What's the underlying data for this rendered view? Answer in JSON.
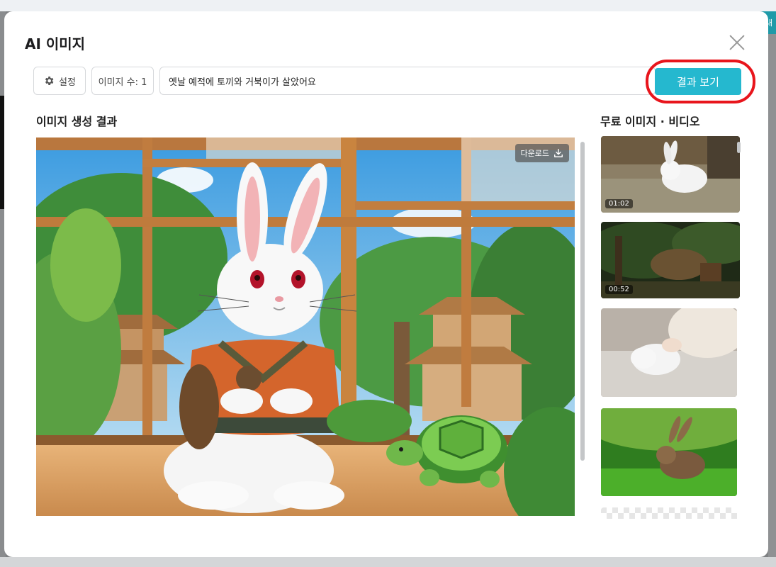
{
  "background": {
    "badge_text": "내"
  },
  "modal": {
    "title": "AI 이미지",
    "toolbar": {
      "settings_label": "설정",
      "image_count_label": "이미지 수: 1",
      "prompt_value": "옛날 예적에 토끼와 거북이가 살았어요",
      "result_button_label": "결과 보기"
    },
    "result_section": {
      "title": "이미지 생성 결과",
      "download_label": "다운로드"
    },
    "free_section": {
      "title": "무료 이미지 · 비디오",
      "items": [
        {
          "kind": "video",
          "duration": "01:02",
          "subject": "white-rabbit-on-grass"
        },
        {
          "kind": "video",
          "duration": "00:52",
          "subject": "forest-cottage"
        },
        {
          "kind": "image",
          "subject": "white-rabbit-on-rug"
        },
        {
          "kind": "image",
          "subject": "brown-rabbit-in-grass"
        },
        {
          "kind": "image",
          "subject": "transparent-pattern"
        }
      ]
    }
  },
  "colors": {
    "accent": "#25b8cf",
    "highlight": "#e8151c"
  }
}
